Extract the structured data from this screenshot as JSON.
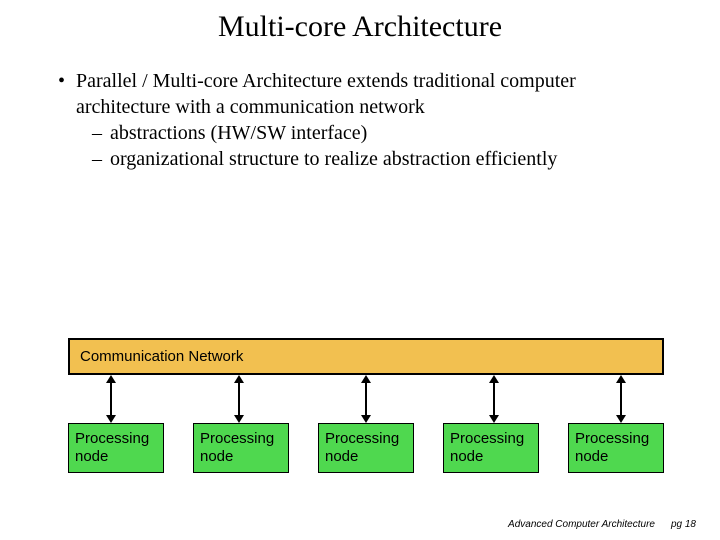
{
  "title": "Multi-core Architecture",
  "bullet": {
    "marker": "•",
    "text": "Parallel / Multi-core Architecture extends traditional computer architecture with a communication network",
    "sub": [
      {
        "marker": "–",
        "text": "abstractions (HW/SW interface)"
      },
      {
        "marker": "–",
        "text": "organizational structure to realize abstraction efficiently"
      }
    ]
  },
  "diagram": {
    "comm_label": "Communication Network",
    "comm_bg": "#f2c050",
    "node_bg": "#4fd84f",
    "nodes": [
      {
        "label": "Processing\nnode"
      },
      {
        "label": "Processing\nnode"
      },
      {
        "label": "Processing\nnode"
      },
      {
        "label": "Processing\nnode"
      },
      {
        "label": "Processing\nnode"
      }
    ]
  },
  "footer": {
    "course": "Advanced Computer Architecture",
    "page": "pg 18"
  }
}
